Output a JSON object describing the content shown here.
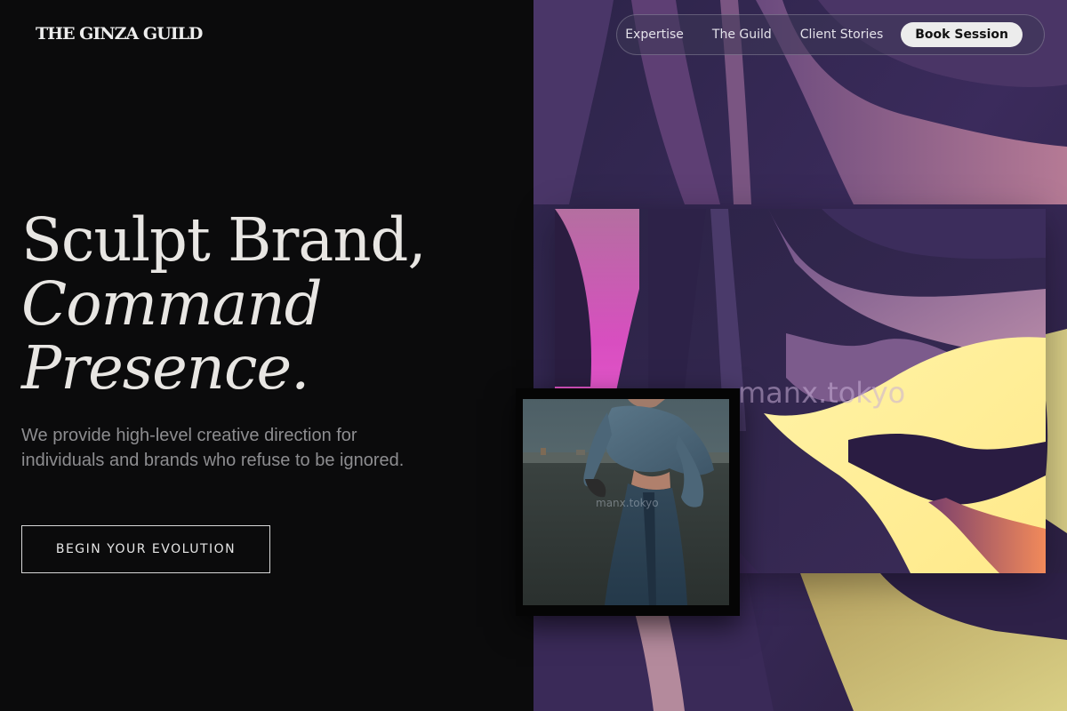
{
  "brand": {
    "name": "THE GINZA GUILD"
  },
  "nav": {
    "links": [
      "Expertise",
      "The Guild",
      "Client Stories"
    ],
    "cta": "Book Session"
  },
  "hero": {
    "headline_line1": "Sculpt Brand,",
    "headline_line2": "Command",
    "headline_line3": "Presence.",
    "subtitle": "We provide high-level creative direction for individuals and brands who refuse to be ignored.",
    "cta": "BEGIN YOUR EVOLUTION"
  },
  "images": {
    "watermark_large": "manx.tokyo",
    "watermark_small": "manx.tokyo"
  },
  "colors": {
    "background": "#0b0b0c",
    "text_primary": "#e8e6e3",
    "text_muted": "#8d8d90",
    "art_purple": "#3a2a5e",
    "art_magenta": "#d050b8",
    "art_yellow": "#fff29a"
  }
}
